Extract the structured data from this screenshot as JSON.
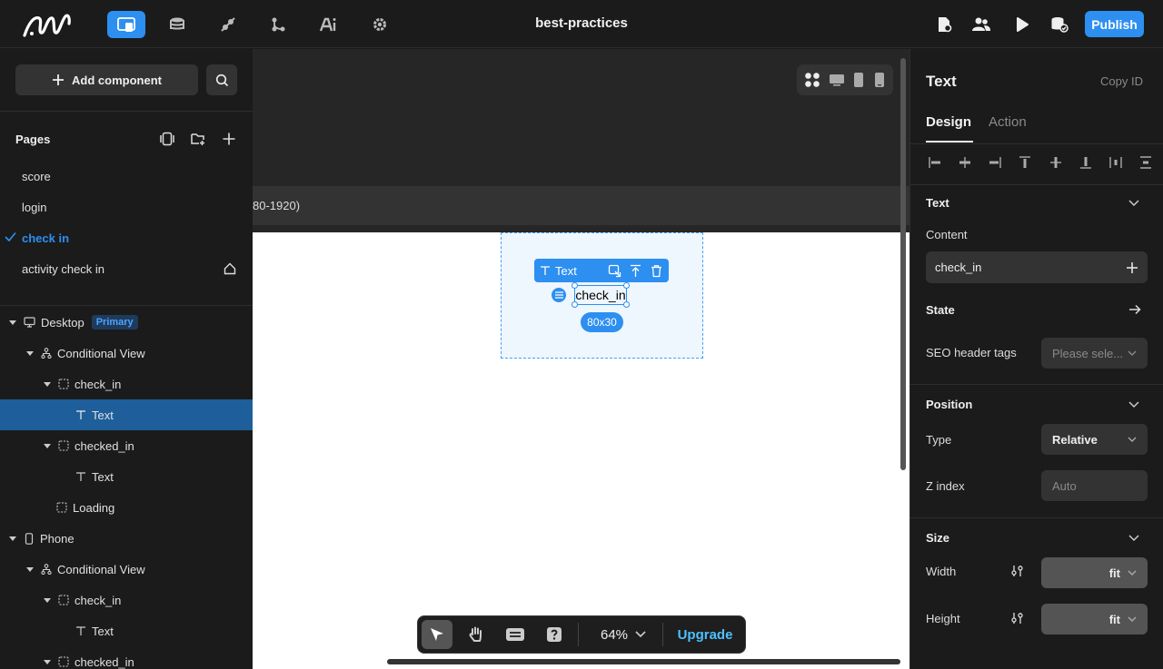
{
  "app": {
    "title": "best-practices",
    "publish_label": "Publish",
    "colors": {
      "accent": "#2d8ff0",
      "selected_row": "#1e5e9a",
      "upgrade": "#4ec0ff"
    },
    "nav_icons": [
      "pages-icon",
      "database-icon",
      "plugin-icon",
      "workflow-icon",
      "ai-icon",
      "gear-icon"
    ],
    "right_icons": [
      "page-settings-icon",
      "users-icon",
      "play-icon",
      "data-check-icon"
    ]
  },
  "left": {
    "add_component_label": "Add component",
    "pages_title": "Pages",
    "pages": [
      {
        "label": "score",
        "active": false
      },
      {
        "label": "login",
        "active": false
      },
      {
        "label": "check in",
        "active": true
      },
      {
        "label": "activity check in",
        "active": false,
        "home": true
      }
    ],
    "tree": [
      {
        "label": "Desktop",
        "badge": "Primary"
      },
      {
        "label": "Conditional View"
      },
      {
        "label": "check_in"
      },
      {
        "label": "Text",
        "selected": true
      },
      {
        "label": "checked_in"
      },
      {
        "label": "Text"
      },
      {
        "label": "Loading"
      },
      {
        "label": "Phone"
      },
      {
        "label": "Conditional View"
      },
      {
        "label": "check_in"
      },
      {
        "label": "Text"
      },
      {
        "label": "checked_in"
      }
    ]
  },
  "canvas": {
    "breakpoint_label": "80-1920)",
    "element_toolbar_label": "Text",
    "element_text": "check_in",
    "size_label": "80x30",
    "zoom_label": "64%",
    "upgrade_label": "Upgrade"
  },
  "right": {
    "title": "Text",
    "copy_id_label": "Copy ID",
    "tabs": [
      "Design",
      "Action"
    ],
    "text_section": "Text",
    "content_label": "Content",
    "content_value": "check_in",
    "state_label": "State",
    "seo_label": "SEO header tags",
    "seo_placeholder": "Please sele...",
    "position_section": "Position",
    "type_label": "Type",
    "type_value": "Relative",
    "zindex_label": "Z index",
    "zindex_placeholder": "Auto",
    "size_section": "Size",
    "width_label": "Width",
    "width_value": "fit",
    "height_label": "Height",
    "height_value": "fit"
  }
}
